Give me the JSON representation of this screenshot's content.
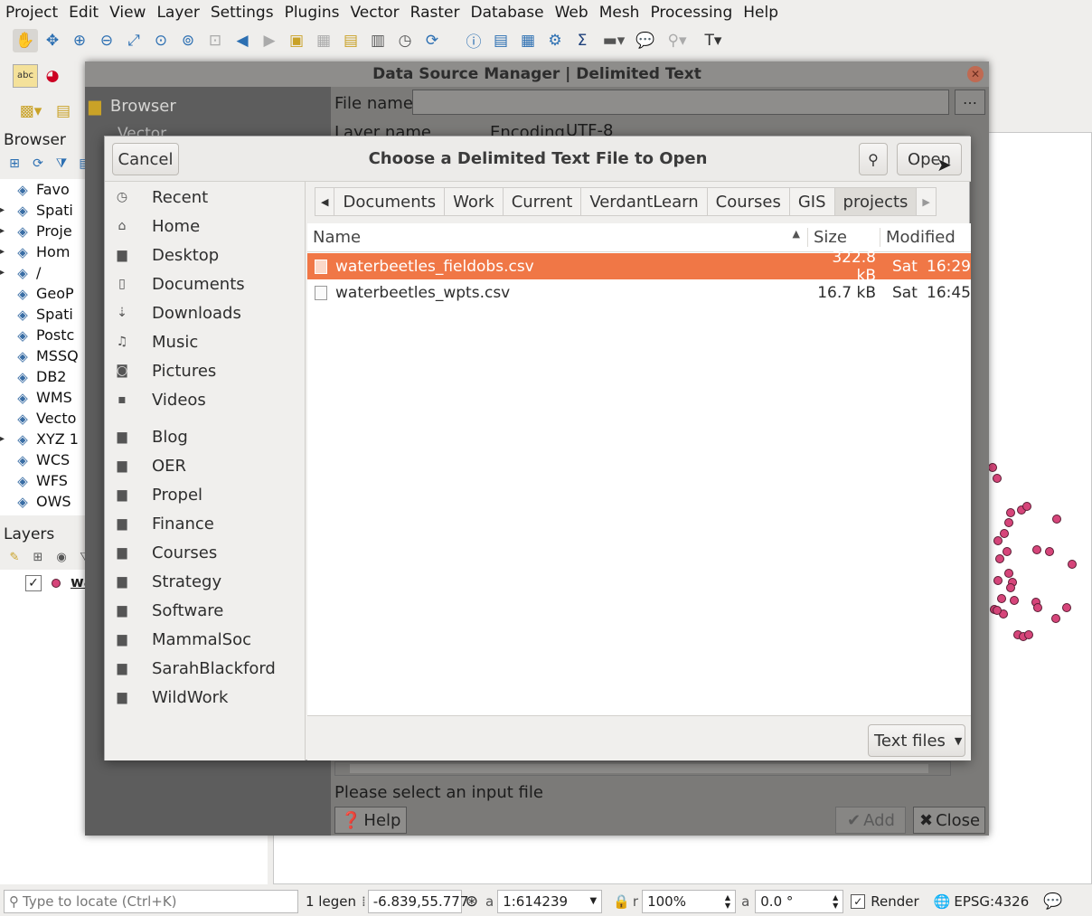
{
  "menubar": [
    "Project",
    "Edit",
    "View",
    "Layer",
    "Settings",
    "Plugins",
    "Vector",
    "Raster",
    "Database",
    "Web",
    "Mesh",
    "Processing",
    "Help"
  ],
  "browser_panel": {
    "title": "Browser",
    "items": [
      {
        "label": "Favo",
        "icon": "star-icon",
        "arrow": ""
      },
      {
        "label": "Spati",
        "icon": "spatial-bookmark-icon",
        "arrow": "▸"
      },
      {
        "label": "Proje",
        "icon": "project-home-icon",
        "arrow": "▸"
      },
      {
        "label": "Hom",
        "icon": "home-folder-icon",
        "arrow": "▸"
      },
      {
        "label": "/",
        "icon": "folder-icon",
        "arrow": "▸"
      },
      {
        "label": "GeoP",
        "icon": "geopackage-icon",
        "arrow": ""
      },
      {
        "label": "Spati",
        "icon": "spatialite-icon",
        "arrow": ""
      },
      {
        "label": "Postc",
        "icon": "postgis-icon",
        "arrow": ""
      },
      {
        "label": "MSSQ",
        "icon": "mssql-icon",
        "arrow": ""
      },
      {
        "label": "DB2",
        "icon": "db2-icon",
        "arrow": ""
      },
      {
        "label": "WMS",
        "icon": "wms-icon",
        "arrow": ""
      },
      {
        "label": "Vecto",
        "icon": "vector-tile-icon",
        "arrow": ""
      },
      {
        "label": "XYZ 1",
        "icon": "xyz-tiles-icon",
        "arrow": "▸"
      },
      {
        "label": "WCS",
        "icon": "wcs-icon",
        "arrow": ""
      },
      {
        "label": "WFS",
        "icon": "wfs-icon",
        "arrow": ""
      },
      {
        "label": "OWS",
        "icon": "ows-icon",
        "arrow": ""
      }
    ]
  },
  "layers_panel": {
    "title": "Layers",
    "layer_label": "wa"
  },
  "dsm": {
    "title": "Data Source Manager | Delimited Text",
    "sidebar_items": [
      "Browser",
      "Vector"
    ],
    "file_name_label": "File name",
    "file_name_value": "",
    "browse_label": "…",
    "layer_name_label": "Layer name",
    "encoding_label": "Encoding",
    "encoding_value": "UTF-8",
    "status_message": "Please select an input file",
    "help_label": "Help",
    "add_label": "Add",
    "close_label": "Close"
  },
  "file_chooser": {
    "title": "Choose a Delimited Text File to Open",
    "cancel_label": "Cancel",
    "open_label": "Open",
    "places": [
      {
        "label": "Recent",
        "icon": "recent-icon",
        "glyph": "◷"
      },
      {
        "label": "Home",
        "icon": "home-icon",
        "glyph": "⌂"
      },
      {
        "label": "Desktop",
        "icon": "folder-icon",
        "glyph": "▆"
      },
      {
        "label": "Documents",
        "icon": "document-icon",
        "glyph": "▯"
      },
      {
        "label": "Downloads",
        "icon": "download-icon",
        "glyph": "⇣"
      },
      {
        "label": "Music",
        "icon": "music-icon",
        "glyph": "♫"
      },
      {
        "label": "Pictures",
        "icon": "camera-icon",
        "glyph": "◙"
      },
      {
        "label": "Videos",
        "icon": "video-icon",
        "glyph": "▪"
      }
    ],
    "bookmarks": [
      "Blog",
      "OER",
      "Propel",
      "Finance",
      "Courses",
      "Strategy",
      "Software",
      "MammalSoc",
      "SarahBlackford",
      "WildWork"
    ],
    "path": [
      "Documents",
      "Work",
      "Current",
      "VerdantLearn",
      "Courses",
      "GIS",
      "projects"
    ],
    "columns": {
      "name": "Name",
      "size": "Size",
      "modified": "Modified"
    },
    "files": [
      {
        "name": "waterbeetles_fieldobs.csv",
        "size": "322.8 kB",
        "day": "Sat",
        "time": "16:29",
        "selected": true
      },
      {
        "name": "waterbeetles_wpts.csv",
        "size": "16.7 kB",
        "day": "Sat",
        "time": "16:45",
        "selected": false
      }
    ],
    "filter_label": "Text files"
  },
  "statusbar": {
    "locate_placeholder": "Type to locate (Ctrl+K)",
    "legend_text": "1 legen",
    "coordinate_value": "-6.839,55.777",
    "scale_value": "1:614239",
    "magnifier_value": "100%",
    "rotation_value": "0.0 °",
    "render_label": "Render",
    "crs_label": "EPSG:4326"
  },
  "colors": {
    "selection": "#f07746",
    "point_fill": "#d6457a"
  }
}
